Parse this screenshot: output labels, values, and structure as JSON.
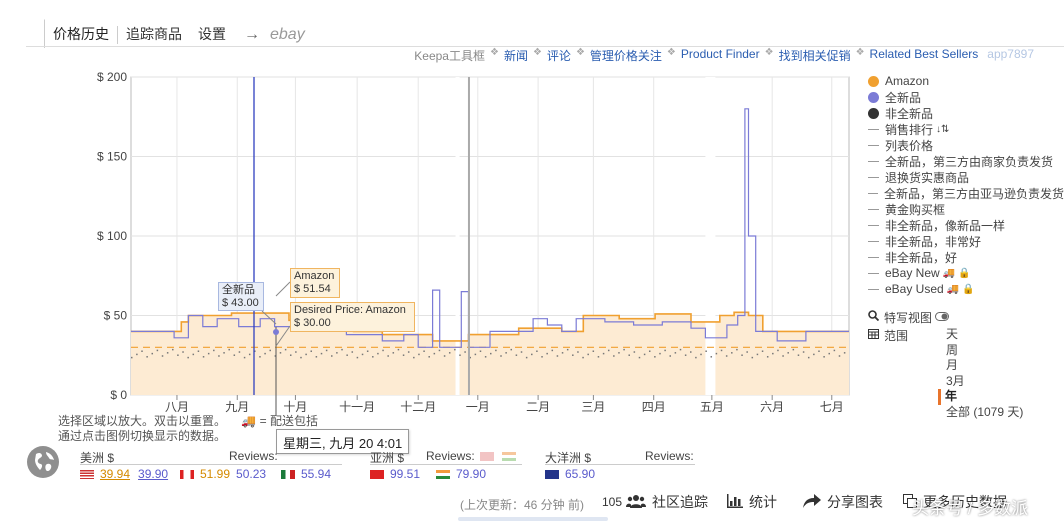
{
  "tabs": [
    {
      "label": "价格历史"
    },
    {
      "label": "追踪商品"
    },
    {
      "label": "设置"
    }
  ],
  "tab_arrow": "→",
  "tab_ebay": "ebay",
  "top_links": {
    "keepa": "Keepa工具框",
    "news": "新闻",
    "reviews": "评论",
    "manage": "管理价格关注",
    "finder": "Product Finder",
    "deals": "找到相关促销",
    "best_sellers": "Related Best Sellers",
    "blurred": "app7897"
  },
  "chart_data": {
    "type": "line",
    "y_ticks": [
      "$ 200",
      "$ 150",
      "$ 100",
      "$ 50",
      "$ 0"
    ],
    "ylim": [
      0,
      200
    ],
    "x_ticks": [
      "八月",
      "九月",
      "十月",
      "十一月",
      "十二月",
      "一月",
      "二月",
      "三月",
      "四月",
      "五月",
      "六月",
      "七月"
    ],
    "desired_price": 30.0,
    "series": [
      {
        "name": "Amazon",
        "color": "#f0a030",
        "points": [
          [
            0,
            40
          ],
          [
            0.06,
            40
          ],
          [
            0.07,
            46
          ],
          [
            0.08,
            50
          ],
          [
            0.12,
            50
          ],
          [
            0.14,
            51.5
          ],
          [
            0.2,
            51.5
          ],
          [
            0.22,
            47
          ],
          [
            0.28,
            44
          ],
          [
            0.31,
            40
          ],
          [
            0.35,
            38
          ],
          [
            0.4,
            38
          ],
          [
            0.42,
            34
          ],
          [
            0.47,
            38
          ],
          [
            0.52,
            38
          ],
          [
            0.54,
            42
          ],
          [
            0.6,
            40
          ],
          [
            0.63,
            50
          ],
          [
            0.68,
            48
          ],
          [
            0.73,
            51
          ],
          [
            0.78,
            46
          ],
          [
            0.82,
            50
          ],
          [
            0.84,
            52
          ],
          [
            0.86,
            50
          ],
          [
            0.88,
            40
          ],
          [
            0.92,
            40
          ],
          [
            1,
            40
          ]
        ]
      },
      {
        "name": "全新品",
        "color": "#7b7bd6",
        "points": [
          [
            0,
            40
          ],
          [
            0.05,
            40
          ],
          [
            0.06,
            36
          ],
          [
            0.08,
            50
          ],
          [
            0.1,
            43
          ],
          [
            0.12,
            48
          ],
          [
            0.15,
            43
          ],
          [
            0.18,
            48
          ],
          [
            0.2,
            43
          ],
          [
            0.24,
            46
          ],
          [
            0.27,
            44
          ],
          [
            0.3,
            38
          ],
          [
            0.35,
            34
          ],
          [
            0.38,
            38
          ],
          [
            0.4,
            30
          ],
          [
            0.42,
            66
          ],
          [
            0.43,
            30
          ],
          [
            0.45,
            30
          ],
          [
            0.46,
            65
          ],
          [
            0.47,
            30
          ],
          [
            0.5,
            40
          ],
          [
            0.53,
            40
          ],
          [
            0.56,
            48
          ],
          [
            0.58,
            44
          ],
          [
            0.6,
            40
          ],
          [
            0.62,
            48
          ],
          [
            0.66,
            46
          ],
          [
            0.7,
            44
          ],
          [
            0.74,
            46
          ],
          [
            0.78,
            42
          ],
          [
            0.8,
            36
          ],
          [
            0.83,
            44
          ],
          [
            0.845,
            50
          ],
          [
            0.855,
            180
          ],
          [
            0.86,
            100
          ],
          [
            0.865,
            100
          ],
          [
            0.87,
            40
          ],
          [
            0.88,
            40
          ],
          [
            0.9,
            34
          ],
          [
            0.94,
            40
          ],
          [
            1,
            40
          ]
        ]
      }
    ],
    "range_marker_x": 0.415
  },
  "legend": {
    "items": [
      {
        "label": "Amazon",
        "kind": "dot",
        "color": "#f0a030"
      },
      {
        "label": "全新品",
        "kind": "dot",
        "color": "#7b7bd6"
      },
      {
        "label": "非全新品",
        "kind": "dot",
        "color": "#333333"
      },
      {
        "label": "销售排行",
        "kind": "dash"
      },
      {
        "label": "列表价格",
        "kind": "dash"
      },
      {
        "label": "全新品，第三方由商家负责发货",
        "kind": "dash"
      },
      {
        "label": "退换货实惠商品",
        "kind": "dash"
      },
      {
        "label": "全新品，第三方由亚马逊负责发货",
        "kind": "dash"
      },
      {
        "label": "黄金购买框",
        "kind": "dash"
      },
      {
        "label": "非全新品，像新品一样",
        "kind": "dash"
      },
      {
        "label": "非全新品，非常好",
        "kind": "dash"
      },
      {
        "label": "非全新品，好",
        "kind": "dash"
      },
      {
        "label": "eBay New",
        "kind": "dash"
      },
      {
        "label": "eBay Used",
        "kind": "dash"
      }
    ]
  },
  "options": {
    "special_view": "特写视图",
    "range": "范围",
    "range_items": [
      "天",
      "周",
      "月",
      "3月",
      "年",
      "全部 (1079 天)"
    ]
  },
  "tooltips": {
    "new_label": "全新品",
    "new_value": "$ 43.00",
    "amazon_label": "Amazon",
    "amazon_value": "$ 51.54",
    "desired_label": "Desired Price: Amazon",
    "desired_value": "$ 30.00",
    "date": "星期三, 九月 20 4:01"
  },
  "hints": {
    "line1": "选择区域以放大。双击以重置。",
    "shipping": "= 配送包括",
    "line2": "通过点击图例切换显示的数据。"
  },
  "marketplaces": {
    "americas": {
      "label": "美洲 $",
      "reviews": "Reviews:",
      "prices": [
        {
          "country": "us",
          "p1": "39.94",
          "p2": "39.90"
        },
        {
          "country": "ca",
          "p1": "51.99",
          "p2": "50.23"
        },
        {
          "country": "mx",
          "p2": "55.94"
        }
      ]
    },
    "asia": {
      "label": "亚洲 $",
      "reviews": "Reviews:",
      "prices": [
        {
          "country": "cn",
          "p2": "99.51"
        },
        {
          "country": "in",
          "p2": "79.90"
        }
      ]
    },
    "oceania": {
      "label": "大洋洲 $",
      "reviews": "Reviews:",
      "prices": [
        {
          "country": "au",
          "p2": "65.90"
        }
      ]
    }
  },
  "bottom": {
    "updated": "(上次更新：46 分钟 前)",
    "community_count": "105",
    "community": "社区追踪",
    "stats": "统计",
    "share": "分享图表",
    "more": "更多历史数据",
    "watermark": "头条号 / 多数派"
  }
}
